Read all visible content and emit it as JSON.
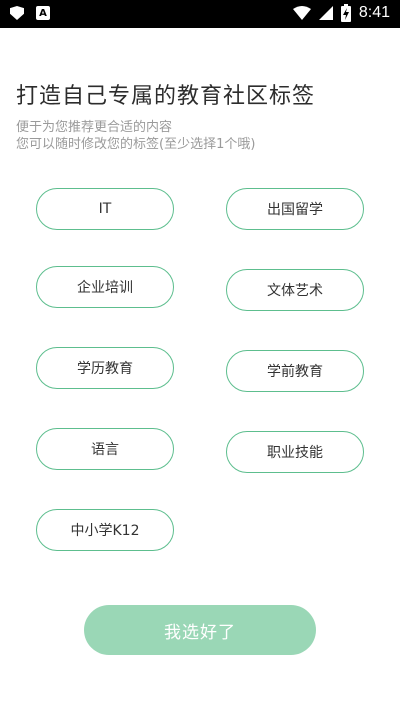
{
  "status_bar": {
    "time": "8:41",
    "icons": [
      "shield-icon",
      "a-box-icon",
      "wifi-icon",
      "signal-icon",
      "battery-charging-icon"
    ]
  },
  "header": {
    "title": "打造自己专属的教育社区标签",
    "subtitle_line1": "便于为您推荐更合适的内容",
    "subtitle_line2": "您可以随时修改您的标签(至少选择1个哦)"
  },
  "tags": [
    {
      "label": "IT"
    },
    {
      "label": "出国留学"
    },
    {
      "label": "企业培训"
    },
    {
      "label": "文体艺术"
    },
    {
      "label": "学历教育"
    },
    {
      "label": "学前教育"
    },
    {
      "label": "语言"
    },
    {
      "label": "职业技能"
    },
    {
      "label": "中小学K12"
    }
  ],
  "confirm_button": {
    "label": "我选好了"
  },
  "colors": {
    "tag_border": "#5dbe8e",
    "button_bg": "#9ad7b6",
    "status_bar": "#000000"
  }
}
